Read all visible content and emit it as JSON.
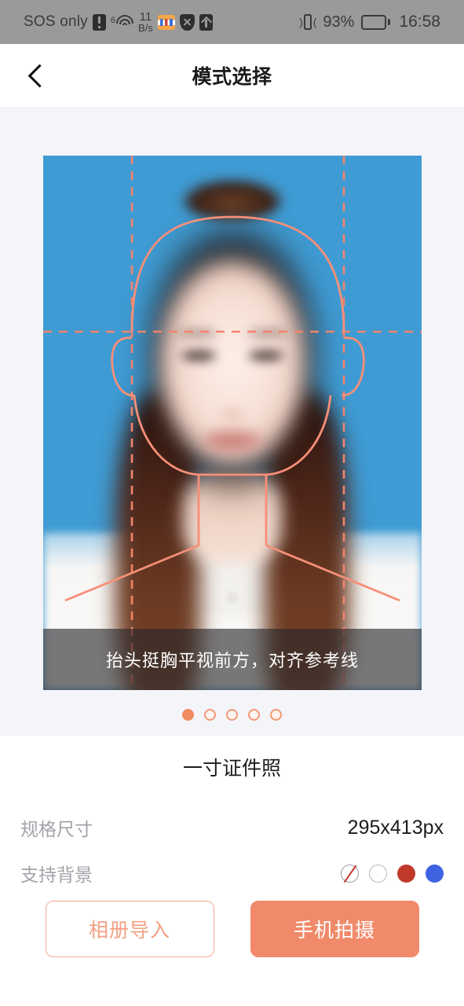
{
  "statusbar": {
    "carrier": "SOS only",
    "wifi_generation": "6",
    "netspeed_value": "11",
    "netspeed_unit": "B/s",
    "battery_percent": "93%",
    "time": "16:58",
    "icons": {
      "alert": "alert-icon",
      "wifi": "wifi-icon",
      "app": "app-icon",
      "shield": "shield-icon",
      "upload": "upload-arrow-icon",
      "vibrate": "vibrate-icon",
      "battery": "battery-icon"
    }
  },
  "navbar": {
    "back_label": "back",
    "title": "模式选择"
  },
  "preview": {
    "caption": "抬头挺胸平视前方，对齐参考线",
    "photo_background_color": "#3f9bd3",
    "guide_color": "#f4836b",
    "pager": {
      "total": 5,
      "active_index": 0,
      "active_color": "#f08a5f",
      "inactive_color": "#f09a74"
    }
  },
  "details": {
    "mode_title": "一寸证件照",
    "rows": [
      {
        "label": "规格尺寸",
        "value": "295x413px"
      },
      {
        "label": "支持背景",
        "value": ""
      }
    ],
    "backgrounds": [
      {
        "name": "none",
        "color": "#ffffff",
        "slash_color": "#c0392b"
      },
      {
        "name": "white",
        "color": "#ffffff"
      },
      {
        "name": "red",
        "color": "#c0392b"
      },
      {
        "name": "blue",
        "color": "#3f62e0"
      }
    ]
  },
  "actions": {
    "album_import": "相册导入",
    "phone_capture": "手机拍摄",
    "outline_color": "#f0a98c",
    "filled_color": "#f08a6a"
  }
}
